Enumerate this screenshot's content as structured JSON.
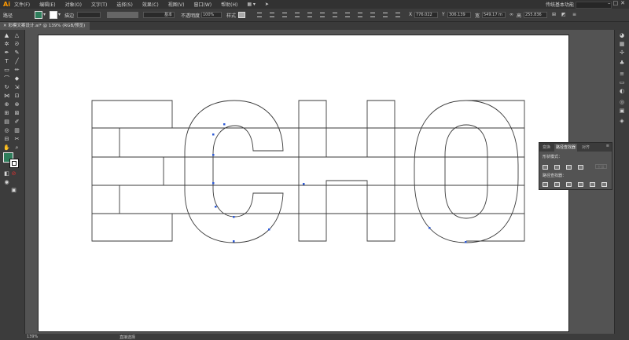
{
  "app": {
    "logo": "Ai"
  },
  "menubar": {
    "items": [
      "文件(F)",
      "编辑(E)",
      "对象(O)",
      "文字(T)",
      "选择(S)",
      "效果(C)",
      "视图(V)",
      "窗口(W)",
      "帮助(H)"
    ],
    "workspace": "传统基本功能"
  },
  "control_bar": {
    "object_label": "路径",
    "stroke_label": "描边",
    "stroke_value": "",
    "stroke_style": "基本",
    "opacity_label": "不透明度",
    "opacity_value": "100%",
    "style_label": "样式",
    "x_label": "X",
    "x_value": "776.022",
    "y_label": "Y",
    "y_value": "306.139",
    "w_label": "宽",
    "w_value": "549.17 m",
    "h_label": "高",
    "h_value": "255.836"
  },
  "document_tab": {
    "title": "彩模文案设计.ai* @ 139% (RGB/预览)"
  },
  "canvas": {
    "text": "ECHO"
  },
  "panel": {
    "tabs": [
      "变换",
      "路径查找器",
      "对齐"
    ],
    "active_tab": "路径查找器",
    "shape_modes_label": "形状模式：",
    "expand_label": "扩展",
    "pathfinders_label": "路径查找器："
  },
  "status_bar": {
    "zoom": "139%",
    "tool": "直接选择"
  },
  "colors": {
    "fill_swatch": "#2e7d5b",
    "accent": "#ff9a00",
    "selection": "#2f5bd6"
  }
}
